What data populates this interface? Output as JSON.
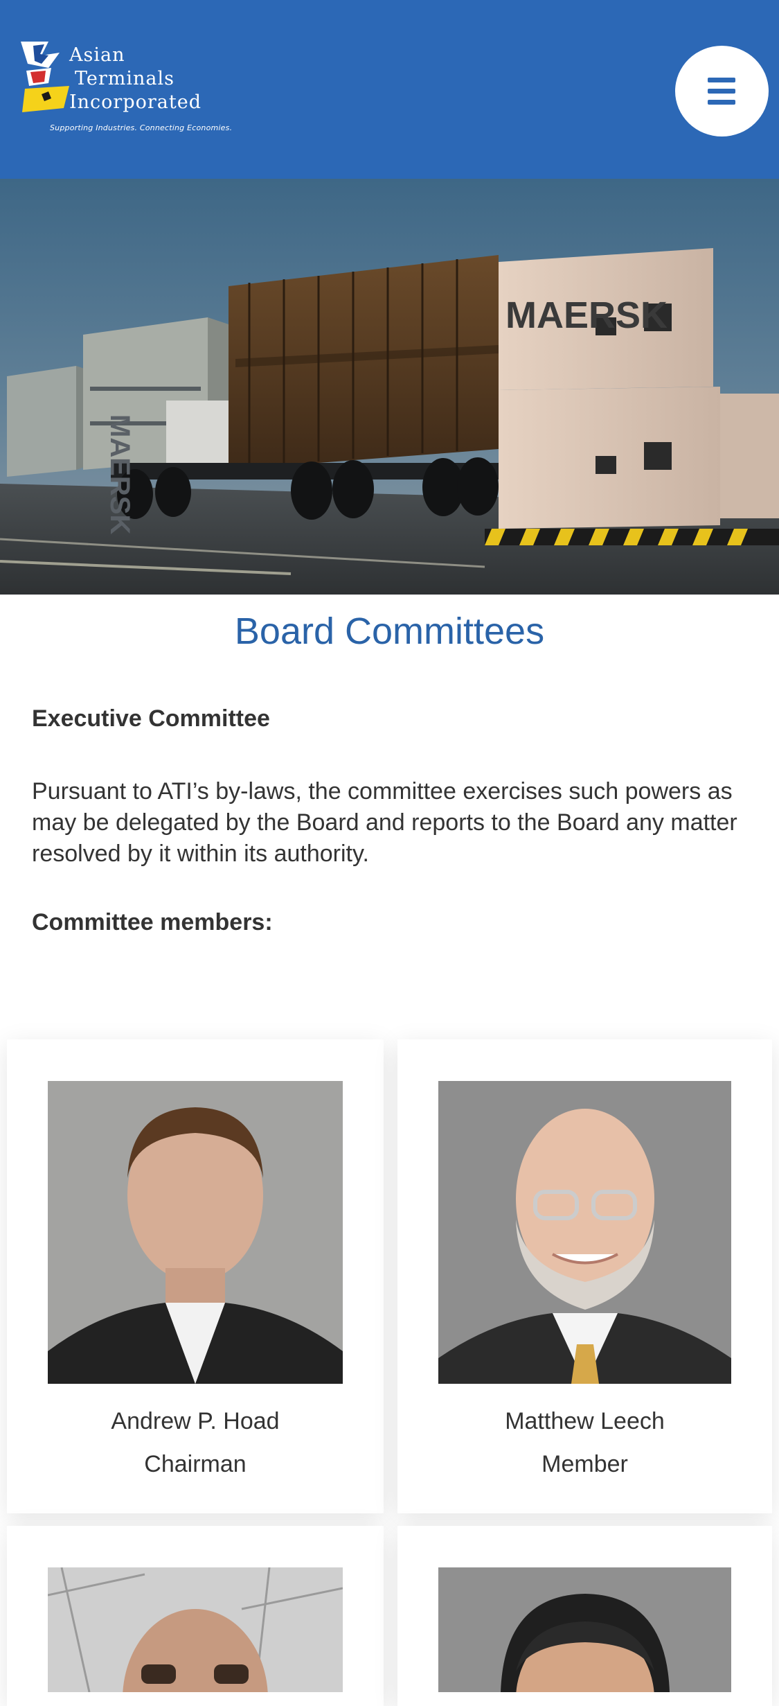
{
  "header": {
    "logo_line1": "Asian",
    "logo_line2": "Terminals",
    "logo_line3": "Incorporated",
    "tagline": "Supporting Industries. Connecting Economies.",
    "menu_icon": "hamburger-menu-icon",
    "brand_color": "#2c68b6"
  },
  "page": {
    "title": "Board Committees",
    "section_title": "Executive Committee",
    "description": "Pursuant to ATI’s by-laws, the committee exercises such powers as may be delegated by the Board and reports to the Board any matter resolved by it within its authority.",
    "members_heading": "Committee members:"
  },
  "members": [
    {
      "name": "Andrew P. Hoad",
      "role": "Chairman"
    },
    {
      "name": "Matthew Leech",
      "role": "Member"
    },
    {
      "name": "",
      "role": ""
    },
    {
      "name": "",
      "role": ""
    }
  ],
  "hero": {
    "container_text": "MAERSK"
  }
}
